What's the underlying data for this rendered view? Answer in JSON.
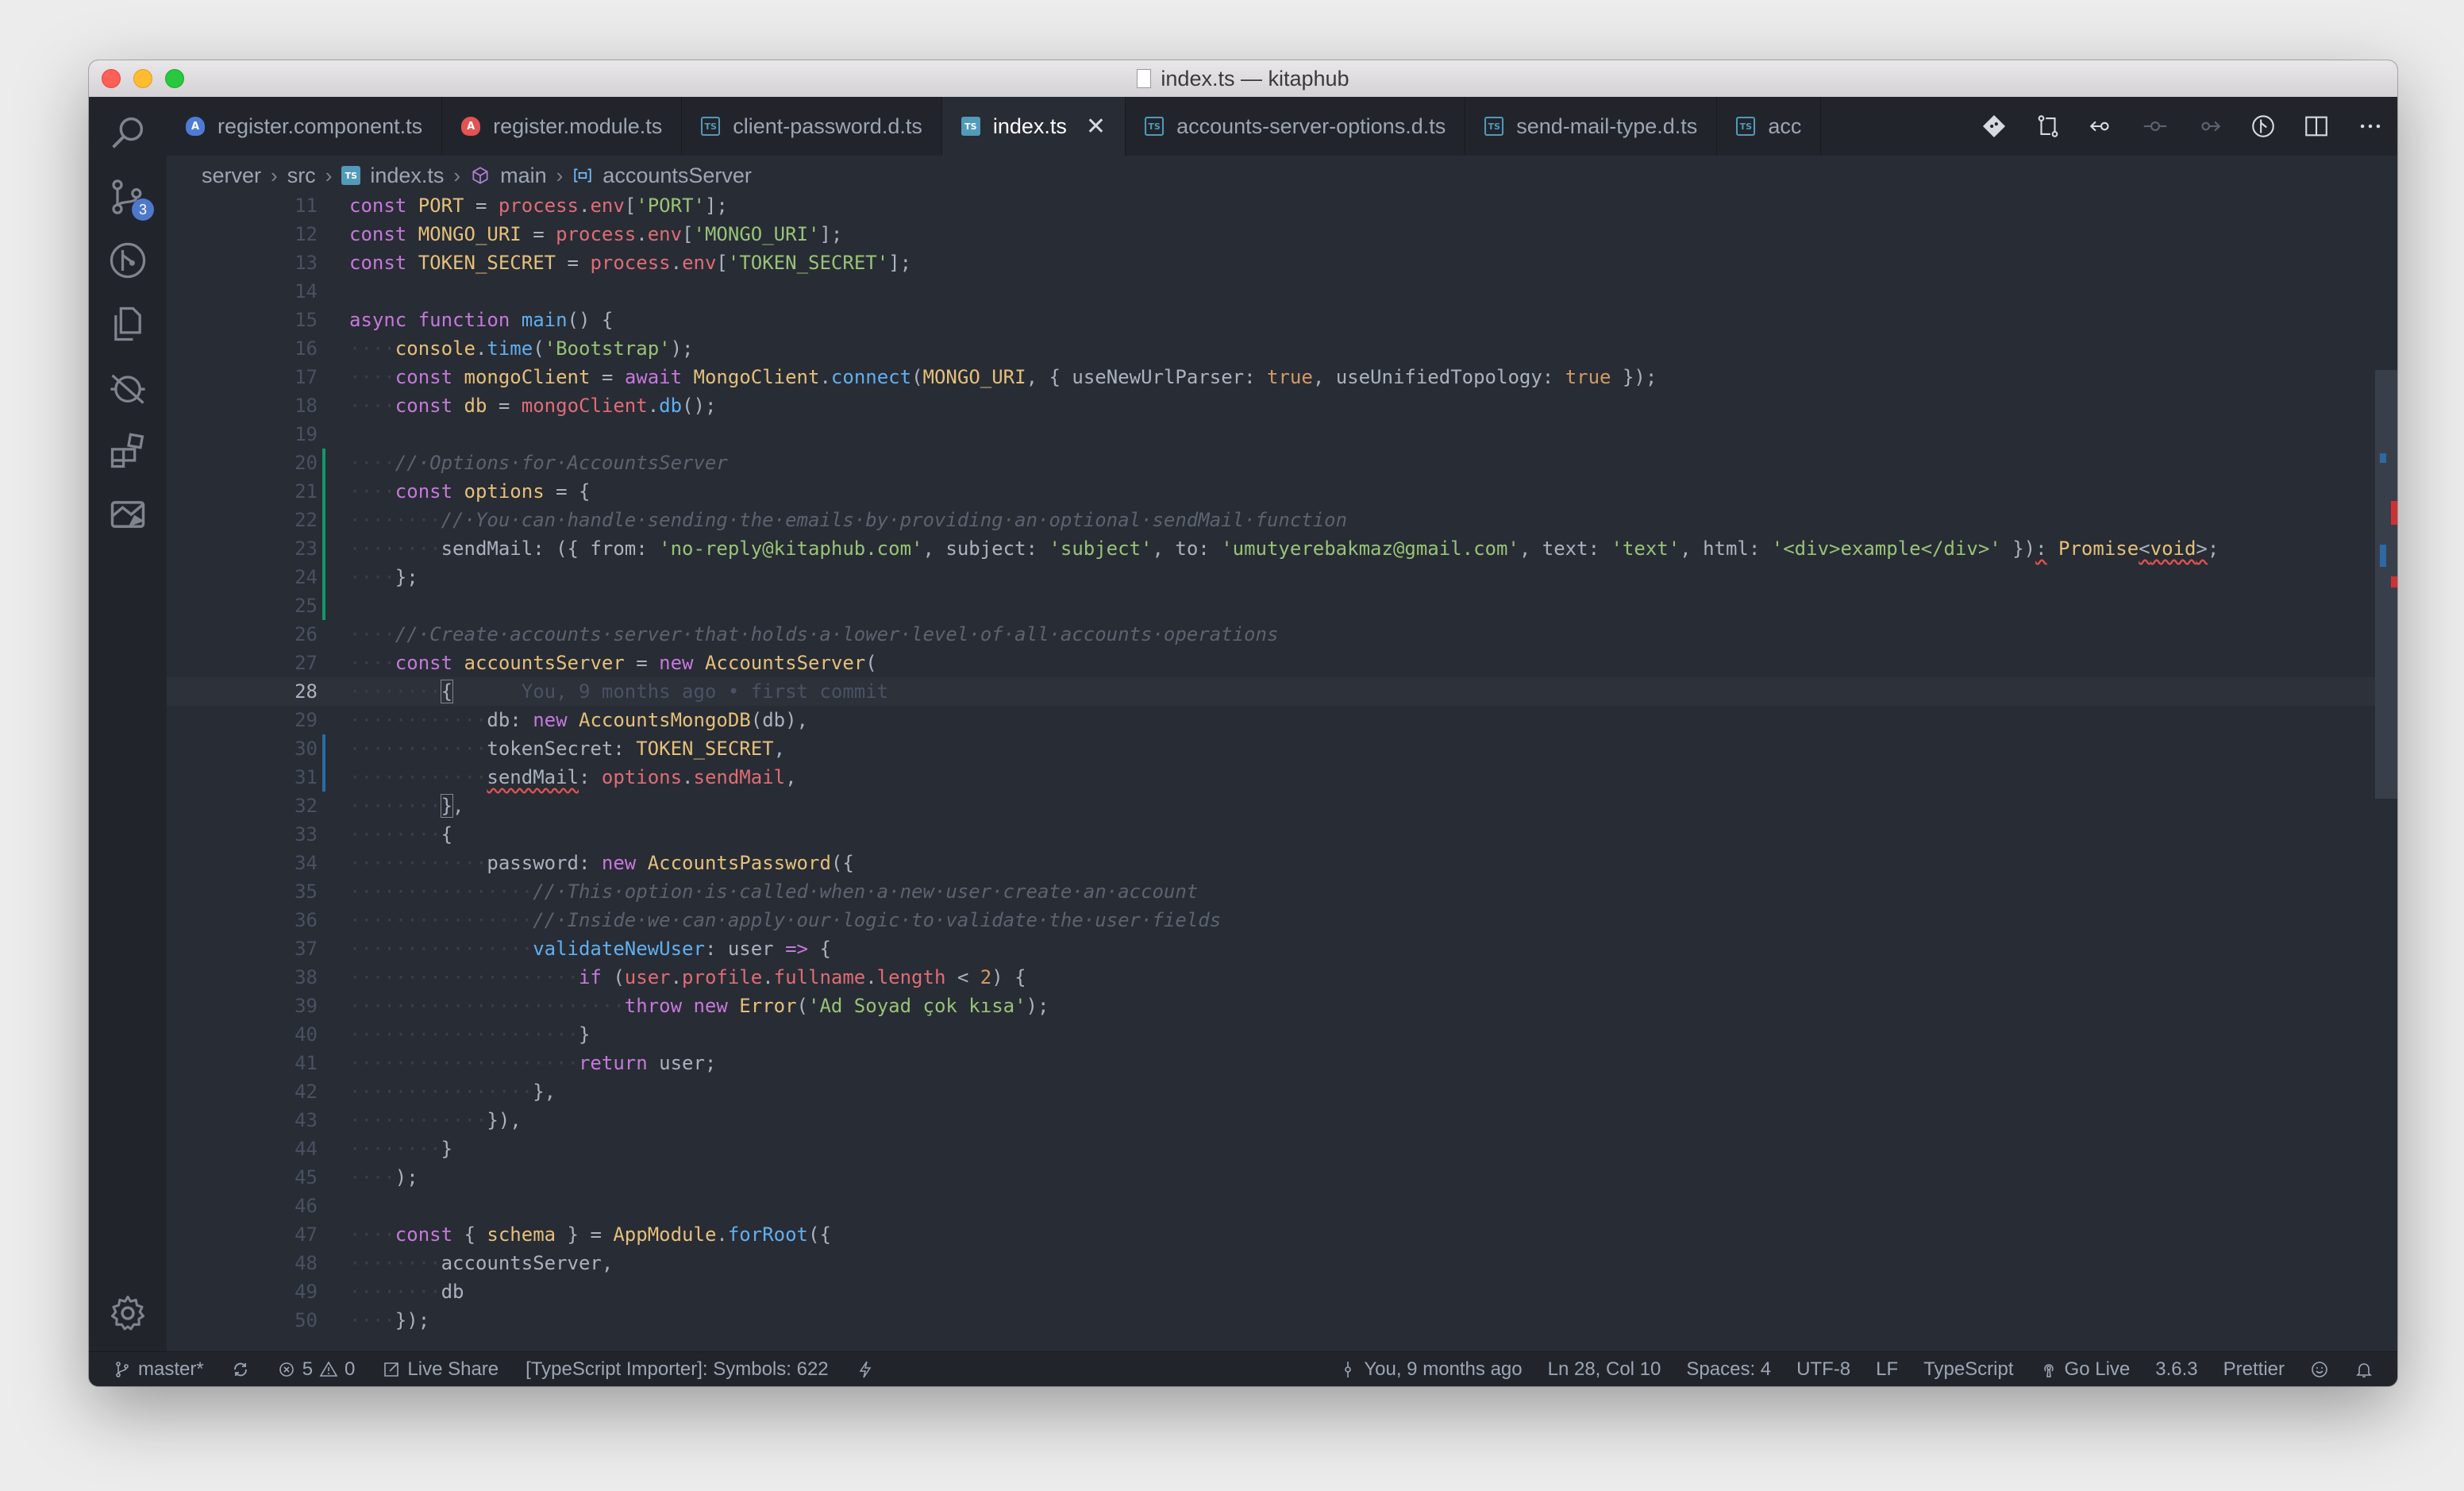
{
  "window": {
    "title": "index.ts — kitaphub"
  },
  "activity_bar": {
    "scm_badge": "3"
  },
  "tabs": [
    {
      "label": "register.component.ts",
      "icon": "angular-icon",
      "active": false
    },
    {
      "label": "register.module.ts",
      "icon": "angular-red-icon",
      "active": false
    },
    {
      "label": "client-password.d.ts",
      "icon": "typescript-def-icon",
      "active": false
    },
    {
      "label": "index.ts",
      "icon": "typescript-icon",
      "active": true
    },
    {
      "label": "accounts-server-options.d.ts",
      "icon": "typescript-def-icon",
      "active": false
    },
    {
      "label": "send-mail-type.d.ts",
      "icon": "typescript-def-icon",
      "active": false
    },
    {
      "label": "acc",
      "icon": "typescript-def-icon",
      "active": false
    }
  ],
  "breadcrumb": [
    "server",
    "src",
    "index.ts",
    "main",
    "accountsServer"
  ],
  "editor": {
    "lines": [
      {
        "num": "11",
        "html": "<span class=\"kw\">const</span> <span class=\"cls\">PORT</span> = <span class=\"var\">process</span>.<span class=\"var\">env</span>[<span class=\"str\">'PORT'</span>];"
      },
      {
        "num": "12",
        "html": "<span class=\"kw\">const</span> <span class=\"cls\">MONGO_URI</span> = <span class=\"var\">process</span>.<span class=\"var\">env</span>[<span class=\"str\">'MONGO_URI'</span>];"
      },
      {
        "num": "13",
        "html": "<span class=\"kw\">const</span> <span class=\"cls\">TOKEN_SECRET</span> = <span class=\"var\">process</span>.<span class=\"var\">env</span>[<span class=\"str\">'TOKEN_SECRET'</span>];"
      },
      {
        "num": "14",
        "html": ""
      },
      {
        "num": "15",
        "html": "<span class=\"kw\">async</span> <span class=\"kw\">function</span> <span class=\"fn\">main</span>() {"
      },
      {
        "num": "16",
        "html": "<span class=\"ws\">····</span><span class=\"cls\">console</span>.<span class=\"fn\">time</span>(<span class=\"str\">'Bootstrap'</span>);"
      },
      {
        "num": "17",
        "html": "<span class=\"ws\">····</span><span class=\"kw\">const</span> <span class=\"cls\">mongoClient</span> = <span class=\"kw\">await</span> <span class=\"cls\">MongoClient</span>.<span class=\"fn\">connect</span>(<span class=\"cls\">MONGO_URI</span>, { useNewUrlParser: <span class=\"bool\">true</span>, useUnifiedTopology: <span class=\"bool\">true</span> });"
      },
      {
        "num": "18",
        "html": "<span class=\"ws\">····</span><span class=\"kw\">const</span> <span class=\"cls\">db</span> = <span class=\"var\">mongoClient</span>.<span class=\"fn\">db</span>();"
      },
      {
        "num": "19",
        "html": ""
      },
      {
        "num": "20",
        "gutter": "add",
        "html": "<span class=\"ws\">····</span><span class=\"com\">//·Options·for·AccountsServer</span>"
      },
      {
        "num": "21",
        "gutter": "add",
        "html": "<span class=\"ws\">····</span><span class=\"kw\">const</span> <span class=\"cls\">options</span> = {"
      },
      {
        "num": "22",
        "gutter": "add",
        "html": "<span class=\"ws\">········</span><span class=\"com\">//·You·can·handle·sending·the·emails·by·providing·an·optional·sendMail·function</span>"
      },
      {
        "num": "23",
        "gutter": "add",
        "html": "<span class=\"ws\">········</span>sendMail: ({ from: <span class=\"str\">'no-reply@kitaphub.com'</span>, subject: <span class=\"str\">'subject'</span>, to: <span class=\"str\">'umutyerebakmaz@gmail.com'</span>, text: <span class=\"str\">'text'</span>, html: <span class=\"str\">'&lt;div&gt;example&lt;/div&gt;'</span> })<span class=\"sq\">:</span> <span class=\"cls\">Promise</span><span class=\"sq\">&lt;<span class=\"cls\">void</span>&gt;</span>;"
      },
      {
        "num": "24",
        "gutter": "add",
        "html": "<span class=\"ws\">····</span>};"
      },
      {
        "num": "25",
        "gutter": "add",
        "html": ""
      },
      {
        "num": "26",
        "html": "<span class=\"ws\">····</span><span class=\"com\">//·Create·accounts·server·that·holds·a·lower·level·of·all·accounts·operations</span>"
      },
      {
        "num": "27",
        "html": "<span class=\"ws\">····</span><span class=\"kw\">const</span> <span class=\"cls\">accountsServer</span> = <span class=\"kw\">new</span> <span class=\"cls\">AccountsServer</span>("
      },
      {
        "num": "28",
        "current": true,
        "html": "<span class=\"ws\">········</span><span class=\"brk\">{</span><span class=\"blame\">      You, 9 months ago • first commit</span>"
      },
      {
        "num": "29",
        "html": "<span class=\"ws\">············</span>db: <span class=\"kw\">new</span> <span class=\"cls\">AccountsMongoDB</span>(db),"
      },
      {
        "num": "30",
        "gutter": "mod",
        "html": "<span class=\"ws\">············</span>tokenSecret: <span class=\"cls\">TOKEN_SECRET</span>,"
      },
      {
        "num": "31",
        "gutter": "mod",
        "html": "<span class=\"ws\">············</span><span class=\"sq\">sendMail</span>: <span class=\"var\">options</span>.<span class=\"var\">sendMail</span>,"
      },
      {
        "num": "32",
        "html": "<span class=\"ws\">········</span><span class=\"brk\">}</span>,"
      },
      {
        "num": "33",
        "html": "<span class=\"ws\">········</span>{"
      },
      {
        "num": "34",
        "html": "<span class=\"ws\">············</span>password: <span class=\"kw\">new</span> <span class=\"cls\">AccountsPassword</span>({"
      },
      {
        "num": "35",
        "html": "<span class=\"ws\">················</span><span class=\"com\">//·This·option·is·called·when·a·new·user·create·an·account</span>"
      },
      {
        "num": "36",
        "html": "<span class=\"ws\">················</span><span class=\"com\">//·Inside·we·can·apply·our·logic·to·validate·the·user·fields</span>"
      },
      {
        "num": "37",
        "html": "<span class=\"ws\">················</span><span class=\"fn\">validateNewUser</span>: user <span class=\"kw\">=&gt;</span> {"
      },
      {
        "num": "38",
        "html": "<span class=\"ws\">····················</span><span class=\"kw\">if</span> (<span class=\"var\">user</span>.<span class=\"var\">profile</span>.<span class=\"var\">fullname</span>.<span class=\"var\">length</span> &lt; <span class=\"bool\">2</span>) {"
      },
      {
        "num": "39",
        "html": "<span class=\"ws\">························</span><span class=\"kw\">throw</span> <span class=\"kw\">new</span> <span class=\"cls\">Error</span>(<span class=\"str\">'Ad Soyad çok kısa'</span>);"
      },
      {
        "num": "40",
        "html": "<span class=\"ws\">····················</span>}"
      },
      {
        "num": "41",
        "html": "<span class=\"ws\">····················</span><span class=\"kw\">return</span> user;"
      },
      {
        "num": "42",
        "html": "<span class=\"ws\">················</span>},"
      },
      {
        "num": "43",
        "html": "<span class=\"ws\">············</span>}),"
      },
      {
        "num": "44",
        "html": "<span class=\"ws\">········</span>}"
      },
      {
        "num": "45",
        "html": "<span class=\"ws\">····</span>);"
      },
      {
        "num": "46",
        "html": ""
      },
      {
        "num": "47",
        "html": "<span class=\"ws\">····</span><span class=\"kw\">const</span> { <span class=\"cls\">schema</span> } = <span class=\"cls\">AppModule</span>.<span class=\"fn\">forRoot</span>({"
      },
      {
        "num": "48",
        "html": "<span class=\"ws\">········</span>accountsServer,"
      },
      {
        "num": "49",
        "html": "<span class=\"ws\">········</span>db"
      },
      {
        "num": "50",
        "html": "<span class=\"ws\">····</span>});"
      }
    ]
  },
  "status_bar": {
    "branch": "master*",
    "errors": "5",
    "warnings": "0",
    "live_share": "Live Share",
    "importer": "[TypeScript Importer]: Symbols: 622",
    "blame": "You, 9 months ago",
    "position": "Ln 28, Col 10",
    "spaces": "Spaces: 4",
    "encoding": "UTF-8",
    "eol": "LF",
    "language": "TypeScript",
    "go_live": "Go Live",
    "ts_version": "3.6.3",
    "formatter": "Prettier"
  },
  "colors": {
    "editor_bg": "#282c34",
    "chrome_bg": "#21252b",
    "accent": "#4d78cc",
    "keyword": "#c678dd",
    "string": "#98c379",
    "type": "#e5c07b",
    "function": "#61afef",
    "variable": "#e06c75"
  }
}
